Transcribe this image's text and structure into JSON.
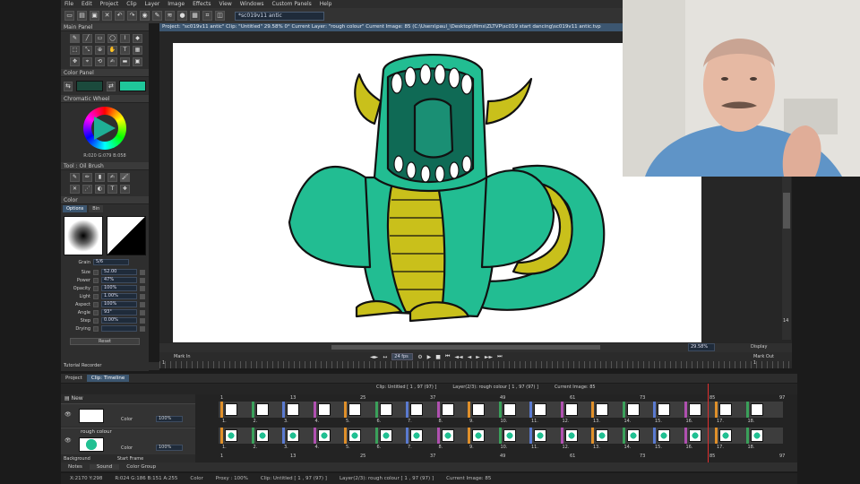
{
  "menu": [
    "File",
    "Edit",
    "Project",
    "Clip",
    "Layer",
    "Image",
    "Effects",
    "View",
    "Windows",
    "Custom Panels",
    "Help"
  ],
  "toolbar": {
    "icons": [
      "new-icon",
      "open-icon",
      "save-icon",
      "close-icon",
      "undo-icon",
      "redo-icon",
      "color-wheel-icon",
      "brush-icon",
      "layers-icon",
      "bulb-icon",
      "grid-icon",
      "crop-icon",
      "frame-icon"
    ],
    "file_tab": "*sc019v11 antic"
  },
  "left": {
    "main_panel": "Main Panel",
    "color_panel": "Color Panel",
    "chromatic_wheel": "Chromatic Wheel",
    "rgb_readout": "R:020 G:079 B:058",
    "tool_title": "Tool : Oil Brush",
    "color_label": "Color",
    "tabs": [
      "Options",
      "Bin"
    ],
    "preview_value": "3.7",
    "grain_label": "Grain",
    "grain_value": "5/6",
    "params": [
      {
        "label": "Size",
        "value": "52.00"
      },
      {
        "label": "Power",
        "value": "47%"
      },
      {
        "label": "Opacity",
        "value": "100%"
      },
      {
        "label": "Light",
        "value": "1.00%"
      },
      {
        "label": "Aspect",
        "value": "100%"
      },
      {
        "label": "Angle",
        "value": "93°"
      },
      {
        "label": "Step",
        "value": "0.00%"
      },
      {
        "label": "Drying",
        "value": ""
      }
    ],
    "reset": "Reset",
    "tutorial": "Tutorial Recorder"
  },
  "colors": {
    "swatch1": "#1b4a3c",
    "swatch2": "#1fc69a",
    "dragon": "#22bd92",
    "dragon_dark": "#0f6a55",
    "belly": "#c9c01b",
    "accent": "#3c5670"
  },
  "doc": {
    "title": "Project: \"sc019v11 antic\"  Clip: \"Untitled\"  29.58%  0°  Current Layer: \"rough colour\"  Current Image: 85 (C:\\Users\\paul_\\Desktop\\films\\ZLTVP\\sc019 start dancing\\sc019v11 antic.tvp",
    "zoom": "29.58%",
    "display": "Display",
    "side_num": "14"
  },
  "timeline": {
    "mark_in": "Mark In",
    "mark_out": "Mark Out",
    "fps": "24 fps",
    "ruler_start": "1",
    "ruler_end": "1",
    "tabs": [
      "Project",
      "Clip: Timeline"
    ],
    "clip_info": "Clip: Untitled [ 1 , 97 (97) ]",
    "layer_info": "Layer(2/3): rough colour [ 1 , 97 (97) ]",
    "current_image": "Current Image: 85",
    "new_label": "New",
    "frame_numbers": [
      "1",
      "13",
      "25",
      "37",
      "49",
      "61",
      "73",
      "85",
      "97"
    ],
    "layers": [
      {
        "name": "",
        "color_label": "Color",
        "opacity": "100%"
      },
      {
        "name": "rough colour",
        "color_label": "Color",
        "opacity": "100%"
      }
    ],
    "cell_numbers_row1": [
      "1.",
      "2.",
      "3.",
      "4.",
      "5.",
      "6.",
      "7.",
      "8.",
      "9.",
      "10.",
      "11.",
      "12.",
      "13.",
      "14.",
      "15.",
      "16.",
      "17.",
      "18."
    ],
    "cell_numbers_row2": [
      "1.",
      "2.",
      "3.",
      "4.",
      "5.",
      "6.",
      "7.",
      "8.",
      "9.",
      "10.",
      "11.",
      "12.",
      "13.",
      "14.",
      "15.",
      "16.",
      "17.",
      "18."
    ]
  },
  "bottom_tabs": [
    "Notes",
    "Sound",
    "Color Group"
  ],
  "background_row": {
    "label": "Background",
    "start_frame": "Start Frame"
  },
  "status": [
    "X:2170  Y:298",
    "R:024 G:186 B:151 A:255",
    "Color",
    "Proxy : 100%",
    "Clip: Untitled [ 1 , 97 (97) ]",
    "Layer(2/3): rough colour [ 1 , 97 (97) ]",
    "Current Image: 85"
  ]
}
